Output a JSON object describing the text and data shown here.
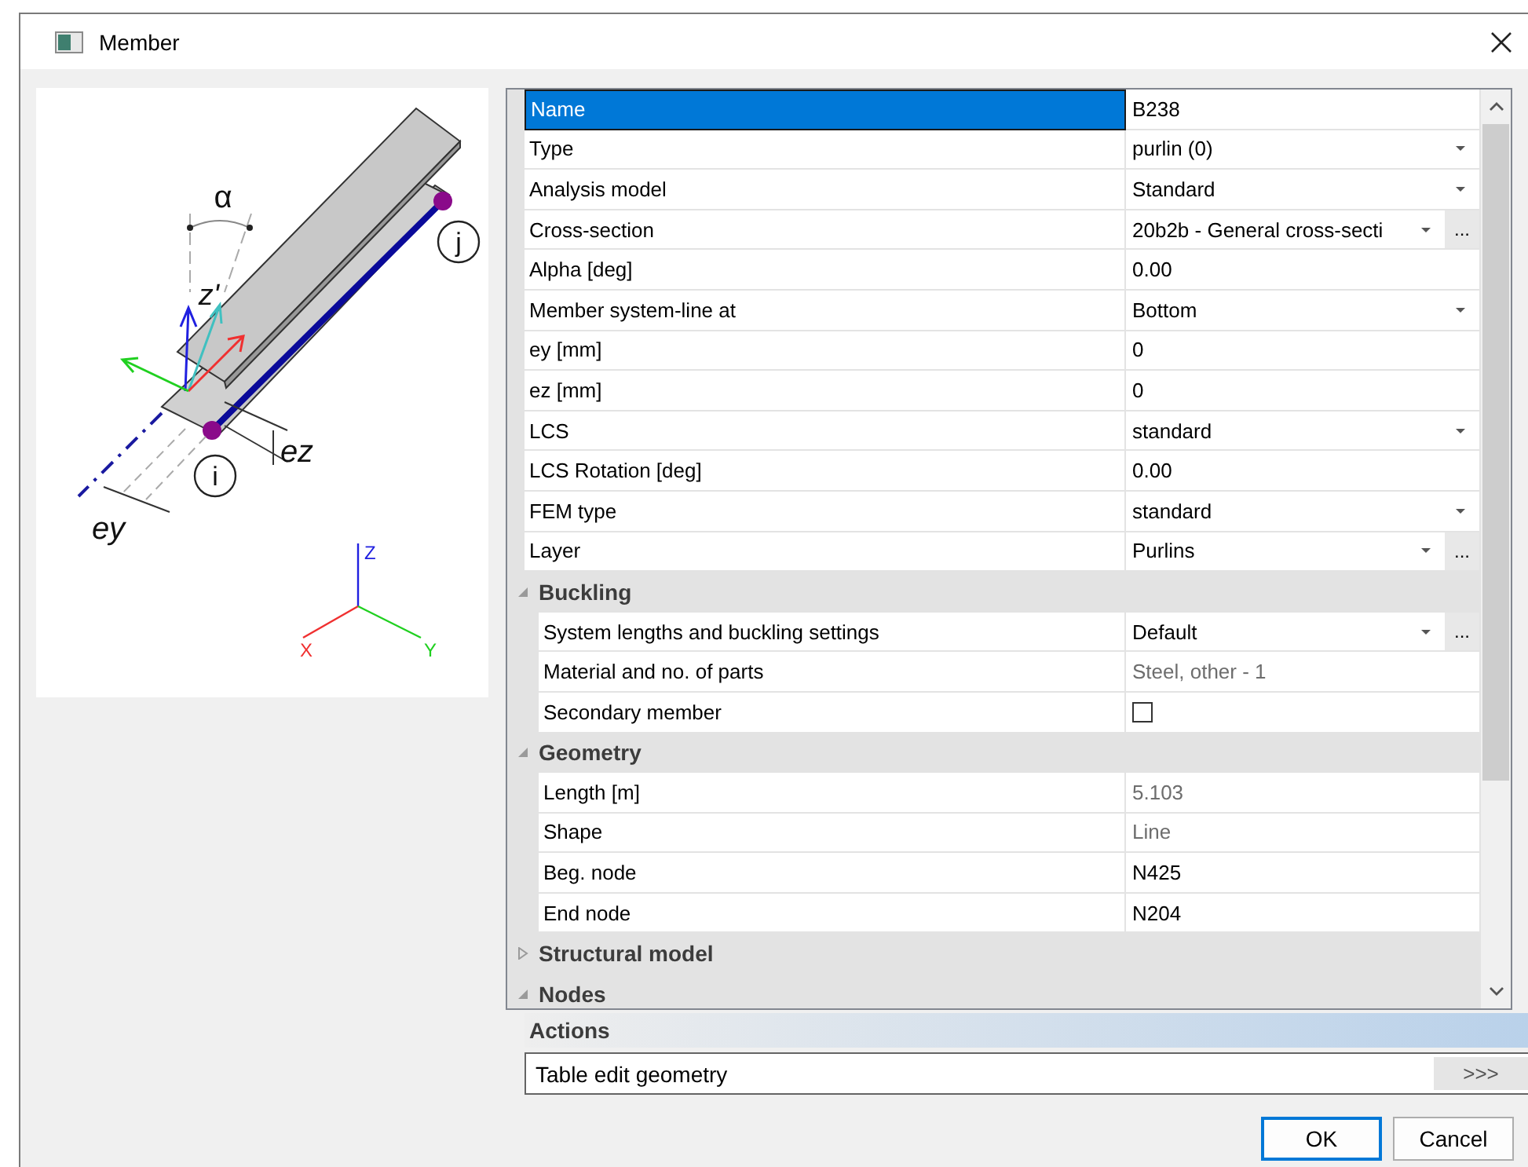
{
  "window": {
    "title": "Member"
  },
  "diagram": {
    "labels": [
      {
        "kind": "alpha",
        "text": "α"
      },
      {
        "kind": "zprime",
        "text": "z'"
      },
      {
        "kind": "j",
        "text": "j"
      },
      {
        "kind": "i",
        "text": "i"
      },
      {
        "kind": "ez",
        "text": "ez"
      },
      {
        "kind": "ey",
        "text": "ey"
      }
    ],
    "axes": [
      {
        "kind": "z",
        "text": "Z",
        "color": "#2020e0"
      },
      {
        "kind": "x",
        "text": "X",
        "color": "#f03030"
      },
      {
        "kind": "y",
        "text": "Y",
        "color": "#20d020"
      }
    ]
  },
  "properties": [
    {
      "kind": "row",
      "label": "Name",
      "value": "B238",
      "selected": true
    },
    {
      "kind": "row",
      "label": "Type",
      "value": "purlin (0)",
      "dropdown": true,
      "selected": false
    },
    {
      "kind": "row",
      "label": "Analysis model",
      "value": "Standard",
      "dropdown": true,
      "selected": false
    },
    {
      "kind": "row",
      "label": "Cross-section",
      "value": "20b2b - General cross-secti",
      "dropdown": true,
      "browse": "...",
      "selected": false
    },
    {
      "kind": "row",
      "label": "Alpha [deg]",
      "value": "0.00",
      "selected": false
    },
    {
      "kind": "row",
      "label": "Member system-line at",
      "value": "Bottom",
      "dropdown": true,
      "selected": false
    },
    {
      "kind": "row",
      "label": "ey [mm]",
      "value": "0",
      "selected": false
    },
    {
      "kind": "row",
      "label": "ez [mm]",
      "value": "0",
      "selected": false
    },
    {
      "kind": "row",
      "label": "LCS",
      "value": "standard",
      "dropdown": true,
      "selected": false
    },
    {
      "kind": "row",
      "label": "LCS Rotation [deg]",
      "value": "0.00",
      "selected": false
    },
    {
      "kind": "row",
      "label": "FEM type",
      "value": "standard",
      "dropdown": true,
      "selected": false
    },
    {
      "kind": "row",
      "label": "Layer",
      "value": "Purlins",
      "dropdown": true,
      "browse": "...",
      "selected": false
    },
    {
      "kind": "group",
      "label": "Buckling",
      "expanded": true,
      "children": [
        {
          "kind": "row",
          "label": "System lengths and buckling settings",
          "value": "Default",
          "dropdown": true,
          "browse": "...",
          "selected": false
        },
        {
          "kind": "row",
          "label": "Material and no. of parts",
          "value": "Steel, other - 1",
          "readonly": true,
          "selected": false
        },
        {
          "kind": "checkbox",
          "label": "Secondary member",
          "checked": false,
          "selected": false
        }
      ]
    },
    {
      "kind": "group",
      "label": "Geometry",
      "expanded": true,
      "children": [
        {
          "kind": "row",
          "label": "Length [m]",
          "value": "5.103",
          "readonly": true,
          "selected": false
        },
        {
          "kind": "row",
          "label": "Shape",
          "value": "Line",
          "readonly": true,
          "selected": false
        },
        {
          "kind": "row",
          "label": "Beg. node",
          "value": "N425",
          "selected": false
        },
        {
          "kind": "row",
          "label": "End node",
          "value": "N204",
          "selected": false
        }
      ]
    },
    {
      "kind": "group",
      "label": "Structural model",
      "expanded": false
    },
    {
      "kind": "group",
      "label": "Nodes",
      "expanded": true
    }
  ],
  "actions": {
    "title": "Actions",
    "items": [
      {
        "label": "Table edit geometry",
        "button": ">>>"
      }
    ]
  },
  "buttons": [
    {
      "label": "OK",
      "default": true
    },
    {
      "label": "Cancel",
      "default": false
    }
  ]
}
